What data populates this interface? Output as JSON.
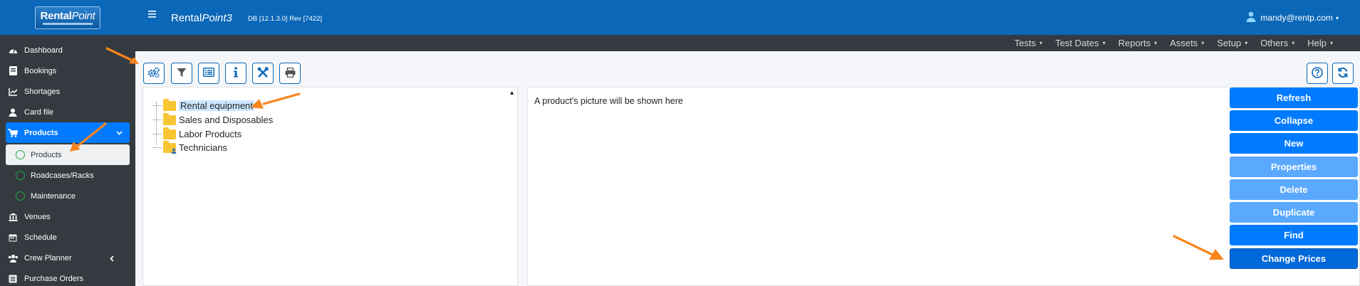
{
  "brand": {
    "logo_text_bold": "Rental",
    "logo_text_italic": "Point"
  },
  "header": {
    "title_plain": "Rental",
    "title_italic": "Point3",
    "db_info": "DB [12.1.3.0]   Rev [7422]",
    "user": "mandy@rentp.com"
  },
  "sidebar": {
    "items": [
      {
        "label": "Dashboard",
        "icon": "dashboard-icon"
      },
      {
        "label": "Bookings",
        "icon": "bookings-icon"
      },
      {
        "label": "Shortages",
        "icon": "chart-icon"
      },
      {
        "label": "Card file",
        "icon": "user-icon"
      },
      {
        "label": "Products",
        "icon": "cart-icon"
      },
      {
        "label": "Products",
        "icon": "circle-icon"
      },
      {
        "label": "Roadcases/Racks",
        "icon": "circle-icon"
      },
      {
        "label": "Maintenance",
        "icon": "circle-icon"
      },
      {
        "label": "Venues",
        "icon": "building-icon"
      },
      {
        "label": "Schedule",
        "icon": "calendar-icon"
      },
      {
        "label": "Crew Planner",
        "icon": "users-icon"
      },
      {
        "label": "Purchase Orders",
        "icon": "list-icon"
      }
    ]
  },
  "menubar": [
    "Tests",
    "Test Dates",
    "Reports",
    "Assets",
    "Setup",
    "Others",
    "Help"
  ],
  "tree": {
    "nodes": [
      "Rental equipment",
      "Sales and Disposables",
      "Labor Products",
      "Technicians"
    ]
  },
  "picture_panel": {
    "placeholder": "A product's picture will be shown here"
  },
  "actions": [
    "Refresh",
    "Collapse",
    "New",
    "Properties",
    "Delete",
    "Duplicate",
    "Find",
    "Change Prices"
  ],
  "colors": {
    "header": "#0b67b8",
    "sidebar": "#343a40",
    "primary": "#007bff",
    "annotation_arrow": "#f7861c"
  }
}
